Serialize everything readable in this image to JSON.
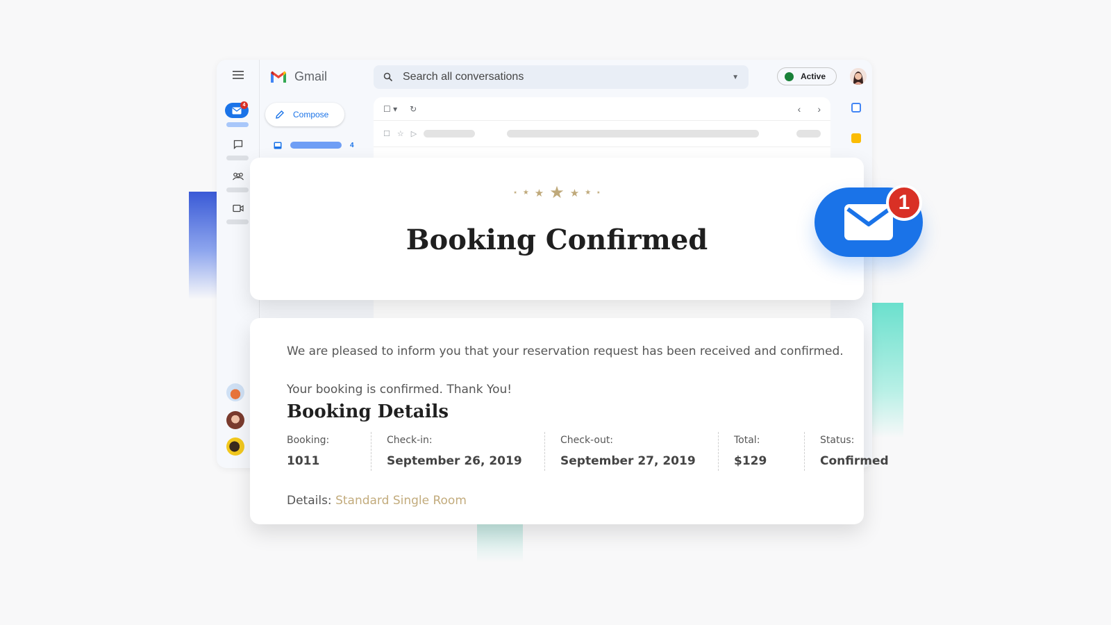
{
  "gmail": {
    "app_name": "Gmail",
    "search_placeholder": "Search all conversations",
    "status": "Active",
    "compose_label": "Compose",
    "rail_unread_badge": "4",
    "inbox_count": "4"
  },
  "confirmation": {
    "title": "Booking Confirmed",
    "intro": "We are pleased to inform you that your reservation request has been received and confirmed.",
    "thanks": "Your booking is confirmed. Thank You!",
    "details_heading": "Booking Details",
    "columns": [
      {
        "label": "Booking:",
        "value": "1011"
      },
      {
        "label": "Check-in:",
        "value": "September 26, 2019"
      },
      {
        "label": "Check-out:",
        "value": "September 27, 2019"
      },
      {
        "label": "Total:",
        "value": "$129"
      },
      {
        "label": "Status:",
        "value": "Confirmed"
      }
    ],
    "details_label": "Details:",
    "details_value": "Standard Single Room"
  },
  "notification": {
    "count": "1"
  },
  "colors": {
    "accent_blue": "#1a73e8",
    "badge_red": "#d93025",
    "gold": "#bfa97a"
  }
}
